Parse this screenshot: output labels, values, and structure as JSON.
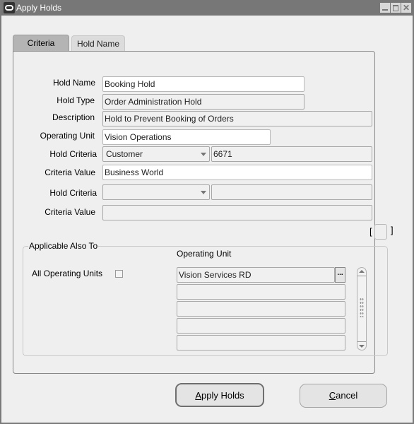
{
  "window": {
    "title": "Apply Holds",
    "controls": {
      "minimize": "minimize",
      "maximize": "maximize",
      "close": "✕"
    }
  },
  "tabs": [
    {
      "label": "Criteria",
      "active": true
    },
    {
      "label": "Hold Name",
      "active": false
    }
  ],
  "form": {
    "hold_name": {
      "label": "Hold Name",
      "value": "Booking Hold"
    },
    "hold_type": {
      "label": "Hold Type",
      "value": "Order Administration Hold"
    },
    "description": {
      "label": "Description",
      "value": "Hold to Prevent Booking of Orders"
    },
    "operating_unit": {
      "label": "Operating Unit",
      "value": "Vision Operations"
    },
    "hold_criteria_1": {
      "label": "Hold Criteria",
      "value": "Customer",
      "code": "6671"
    },
    "criteria_value_1": {
      "label": "Criteria Value",
      "value": "Business World"
    },
    "hold_criteria_2": {
      "label": "Hold Criteria",
      "value": "",
      "code": ""
    },
    "criteria_value_2": {
      "label": "Criteria Value",
      "value": ""
    }
  },
  "bracket": {
    "left": "[",
    "right": "]"
  },
  "applicable": {
    "title": "Applicable Also To",
    "all_operating_units_label": "All Operating Units",
    "all_operating_units_checked": false,
    "column_header": "Operating Unit",
    "rows": [
      "Vision Services RD",
      "",
      "",
      "",
      ""
    ],
    "lov_button": "..."
  },
  "buttons": {
    "apply": {
      "mnemonic": "A",
      "rest": "pply Holds"
    },
    "cancel": {
      "mnemonic": "C",
      "rest": "ancel"
    }
  }
}
